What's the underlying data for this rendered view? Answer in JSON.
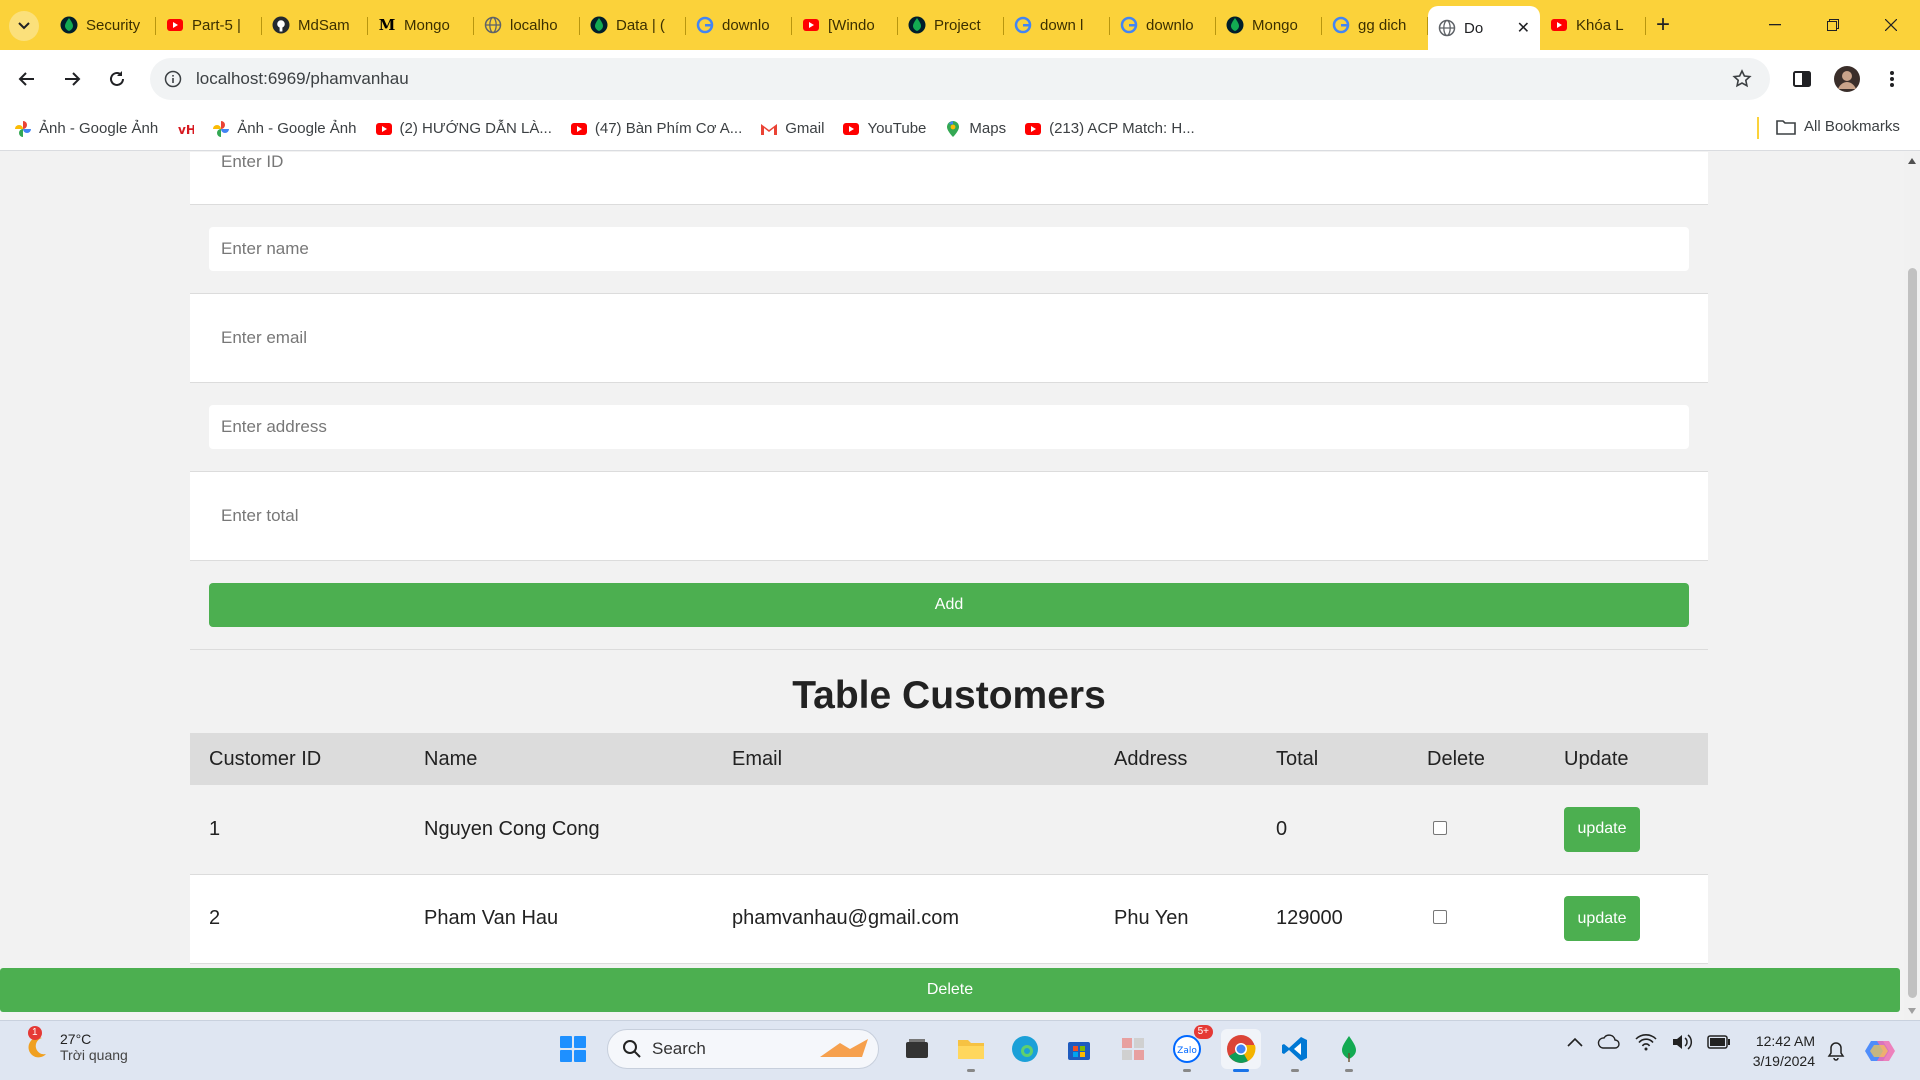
{
  "tabs": [
    {
      "label": "Security",
      "icon": "mongodb-icon",
      "color": "#00684a"
    },
    {
      "label": "Part-5 |",
      "icon": "youtube-icon",
      "color": "#ff0000"
    },
    {
      "label": "MdSam",
      "icon": "github-icon",
      "color": "#24292f"
    },
    {
      "label": "Mongo",
      "icon": "medium-icon",
      "color": "#000000"
    },
    {
      "label": "localho",
      "icon": "globe-icon",
      "color": "#5f6368"
    },
    {
      "label": "Data | (",
      "icon": "mongodb-icon",
      "color": "#00684a"
    },
    {
      "label": "downlo",
      "icon": "google-icon",
      "color": "#4285f4"
    },
    {
      "label": "[Windo",
      "icon": "youtube-icon",
      "color": "#ff0000"
    },
    {
      "label": "Project",
      "icon": "mongodb-icon",
      "color": "#00684a"
    },
    {
      "label": "down l",
      "icon": "google-icon",
      "color": "#4285f4"
    },
    {
      "label": "downlo",
      "icon": "google-icon",
      "color": "#4285f4"
    },
    {
      "label": "Mongo",
      "icon": "mongodb-icon",
      "color": "#00684a"
    },
    {
      "label": "gg dich",
      "icon": "google-icon",
      "color": "#4285f4"
    },
    {
      "label": "Do",
      "icon": "globe-icon",
      "color": "#5f6368",
      "active": true
    },
    {
      "label": "Khóa L",
      "icon": "youtube-icon",
      "color": "#ff0000"
    }
  ],
  "toolbar": {
    "url": "localhost:6969/phamvanhau"
  },
  "bookmarks": [
    {
      "label": "Ảnh - Google Ảnh",
      "icon": "google-photos-icon"
    },
    {
      "label": "",
      "icon": "vn-flag-icon"
    },
    {
      "label": "Ảnh - Google Ảnh",
      "icon": "google-photos-icon"
    },
    {
      "label": "(2) HƯỚNG DẪN LÀ...",
      "icon": "youtube-icon"
    },
    {
      "label": "(47) Bàn Phím Cơ A...",
      "icon": "youtube-icon"
    },
    {
      "label": "Gmail",
      "icon": "gmail-icon"
    },
    {
      "label": "YouTube",
      "icon": "youtube-icon"
    },
    {
      "label": "Maps",
      "icon": "maps-icon"
    },
    {
      "label": "(213) ACP Match: H...",
      "icon": "youtube-icon"
    }
  ],
  "all_bookmarks": "All Bookmarks",
  "form": {
    "id_placeholder": "Enter ID",
    "name_placeholder": "Enter name",
    "email_placeholder": "Enter email",
    "address_placeholder": "Enter address",
    "total_placeholder": "Enter total",
    "add_label": "Add"
  },
  "table": {
    "title": "Table Customers",
    "headers": [
      "Customer ID",
      "Name",
      "Email",
      "Address",
      "Total",
      "Delete",
      "Update"
    ],
    "rows": [
      {
        "id": "1",
        "name": "Nguyen Cong Cong",
        "email": "",
        "address": "",
        "total": "0",
        "update_label": "update"
      },
      {
        "id": "2",
        "name": "Pham Van Hau",
        "email": "phamvanhau@gmail.com",
        "address": "Phu Yen",
        "total": "129000",
        "update_label": "update"
      }
    ],
    "delete_label": "Delete"
  },
  "taskbar": {
    "weather_temp": "27°C",
    "weather_cond": "Trời quang",
    "weather_badge": "1",
    "search_label": "Search",
    "zalo_badge": "5+",
    "time": "12:42 AM",
    "date": "3/19/2024"
  },
  "colors": {
    "tab_strip": "#fbd23a",
    "accent_green": "#4caf50"
  }
}
